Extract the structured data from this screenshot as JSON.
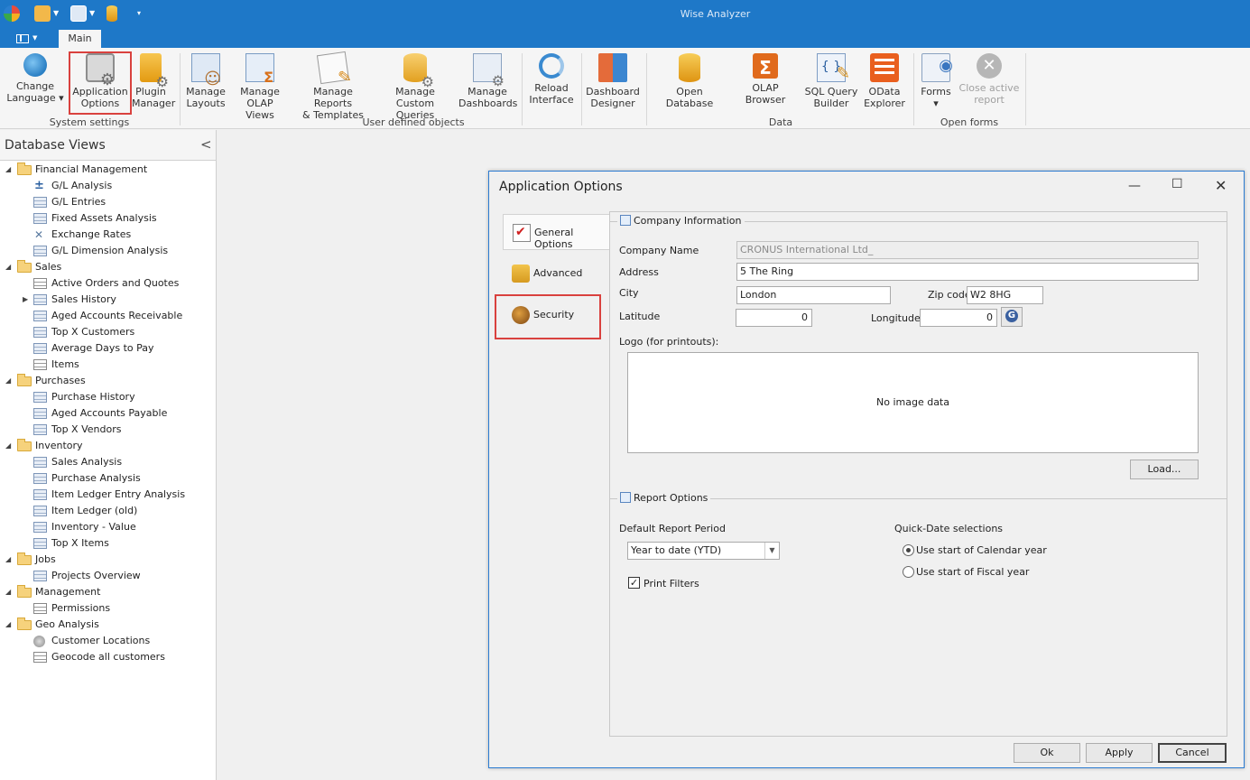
{
  "app": {
    "title": "Wise Analyzer"
  },
  "tabs": {
    "main": "Main"
  },
  "ribbon": {
    "change_language": "Change\nLanguage ▾",
    "application_options": "Application\nOptions",
    "plugin_manager": "Plugin\nManager",
    "manage_layouts": "Manage\nLayouts",
    "manage_olap_views": "Manage\nOLAP Views",
    "manage_reports": "Manage Reports\n& Templates",
    "manage_queries": "Manage Custom\nQueries",
    "manage_dashboards": "Manage\nDashboards",
    "reload_interface": "Reload\nInterface",
    "dashboard_designer": "Dashboard\nDesigner",
    "open_database": "Open Database",
    "olap_browser": "OLAP Browser",
    "sql_query_builder": "SQL Query\nBuilder",
    "odata_explorer": "OData\nExplorer",
    "forms": "Forms\n▾",
    "close_active_report": "Close active\nreport",
    "groups": {
      "system_settings": "System settings",
      "user_defined_objects": "User defined objects",
      "data": "Data",
      "open_forms": "Open forms"
    }
  },
  "left_panel": {
    "title": "Database Views",
    "tree": [
      {
        "label": "Financial Management",
        "type": "category"
      },
      {
        "label": "G/L Analysis",
        "type": "item",
        "icon": "plus"
      },
      {
        "label": "G/L Entries",
        "type": "item"
      },
      {
        "label": "Fixed Assets Analysis",
        "type": "item"
      },
      {
        "label": "Exchange Rates",
        "type": "item",
        "icon": "rate"
      },
      {
        "label": "G/L Dimension Analysis",
        "type": "item"
      },
      {
        "label": "Sales",
        "type": "category"
      },
      {
        "label": "Active Orders and Quotes",
        "type": "item",
        "icon": "plain"
      },
      {
        "label": "Sales History",
        "type": "item",
        "expandable": true
      },
      {
        "label": "Aged Accounts Receivable",
        "type": "item"
      },
      {
        "label": "Top X Customers",
        "type": "item"
      },
      {
        "label": "Average Days to Pay",
        "type": "item"
      },
      {
        "label": "Items",
        "type": "item",
        "icon": "plain"
      },
      {
        "label": "Purchases",
        "type": "category"
      },
      {
        "label": "Purchase History",
        "type": "item"
      },
      {
        "label": "Aged Accounts Payable",
        "type": "item"
      },
      {
        "label": "Top X Vendors",
        "type": "item"
      },
      {
        "label": "Inventory",
        "type": "category"
      },
      {
        "label": "Sales Analysis",
        "type": "item"
      },
      {
        "label": "Purchase Analysis",
        "type": "item"
      },
      {
        "label": "Item Ledger Entry Analysis",
        "type": "item"
      },
      {
        "label": "Item Ledger (old)",
        "type": "item"
      },
      {
        "label": "Inventory - Value",
        "type": "item"
      },
      {
        "label": "Top X Items",
        "type": "item"
      },
      {
        "label": "Jobs",
        "type": "category"
      },
      {
        "label": "Projects Overview",
        "type": "item"
      },
      {
        "label": "Management",
        "type": "category"
      },
      {
        "label": "Permissions",
        "type": "item",
        "icon": "plain"
      },
      {
        "label": "Geo Analysis",
        "type": "category"
      },
      {
        "label": "Customer Locations",
        "type": "item",
        "icon": "globe"
      },
      {
        "label": "Geocode all customers",
        "type": "item",
        "icon": "plain"
      }
    ]
  },
  "dialog": {
    "title": "Application Options",
    "tabs": {
      "general": "General Options",
      "advanced": "Advanced",
      "security": "Security"
    },
    "company": {
      "group_title": "Company Information",
      "name_label": "Company Name",
      "name_value": "CRONUS International Ltd_",
      "address_label": "Address",
      "address_value": "5 The Ring",
      "city_label": "City",
      "city_value": "London",
      "zip_label": "Zip code",
      "zip_value": "W2 8HG",
      "latitude_label": "Latitude",
      "latitude_value": "0",
      "longitude_label": "Longitude",
      "longitude_value": "0",
      "logo_label": "Logo (for printouts):",
      "logo_empty": "No image data",
      "load_button": "Load..."
    },
    "report": {
      "group_title": "Report Options",
      "period_label": "Default Report Period",
      "period_value": "Year to date (YTD)",
      "print_filters": "Print Filters",
      "quick_date_label": "Quick-Date selections",
      "radio_calendar": "Use start of Calendar year",
      "radio_fiscal": "Use start of Fiscal year"
    },
    "buttons": {
      "ok": "Ok",
      "apply": "Apply",
      "cancel": "Cancel"
    }
  },
  "colors": {
    "accent": "#1e78c8",
    "highlight": "#d9413e"
  }
}
